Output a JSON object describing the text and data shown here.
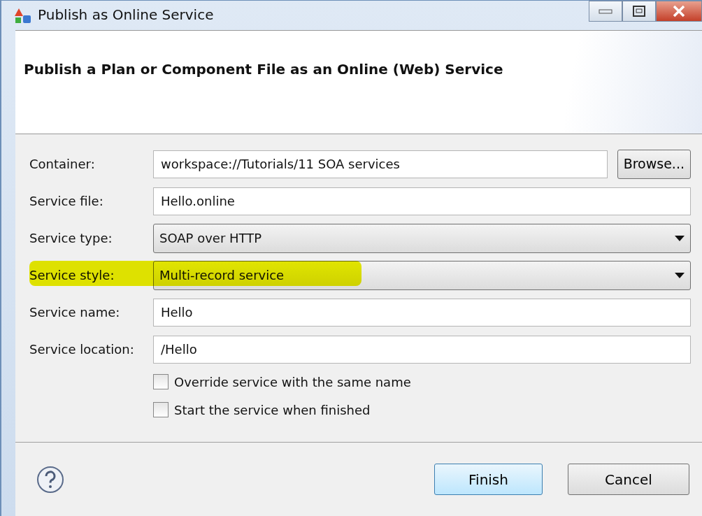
{
  "window": {
    "title": "Publish as Online Service"
  },
  "header": {
    "title": "Publish a Plan or Component File as an Online (Web) Service"
  },
  "fields": [
    {
      "kind": "text_button",
      "label": "Container:",
      "value": "workspace://Tutorials/11 SOA services",
      "button": "Browse...",
      "highlighted": false
    },
    {
      "kind": "text",
      "label": "Service file:",
      "value": "Hello.online",
      "highlighted": false
    },
    {
      "kind": "dropdown",
      "label": "Service type:",
      "value": "SOAP over HTTP",
      "highlighted": false
    },
    {
      "kind": "dropdown",
      "label": "Service style:",
      "value": "Multi-record service",
      "highlighted": true
    },
    {
      "kind": "text",
      "label": "Service name:",
      "value": "Hello",
      "highlighted": false
    },
    {
      "kind": "text",
      "label": "Service location:",
      "value": "/Hello",
      "highlighted": false
    }
  ],
  "options": [
    {
      "label": "Override service with the same name",
      "checked": false
    },
    {
      "label": "Start the service when finished",
      "checked": false
    }
  ],
  "buttons": [
    {
      "label": "Finish",
      "default": true
    },
    {
      "label": "Cancel",
      "default": false
    }
  ]
}
